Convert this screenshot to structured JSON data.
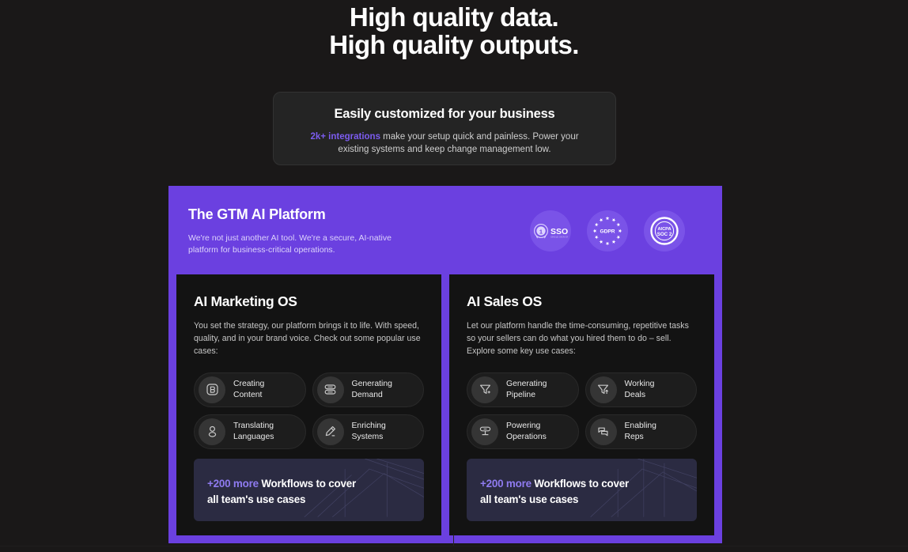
{
  "hero": {
    "line1": "High quality data.",
    "line2": "High quality outputs."
  },
  "customization": {
    "title": "Easily customized for your business",
    "accent": "2k+ integrations",
    "body": " make your setup quick and painless. Power your existing systems and keep change management low."
  },
  "platform": {
    "title": "The GTM AI Platform",
    "subtitle": "We're not just another AI tool. We're a secure, AI-native platform for business-critical operations.",
    "accent_color": "#6b40e0",
    "badges": [
      {
        "name": "sso-badge",
        "label": "SSO"
      },
      {
        "name": "gdpr-badge",
        "label": "GDPR"
      },
      {
        "name": "soc2-badge",
        "label_top": "AICPA",
        "label_bottom": "SOC 2"
      }
    ]
  },
  "cards": [
    {
      "title": "AI Marketing OS",
      "desc": "You set the strategy, our platform brings it to life. With speed, quality, and in your brand voice. Check out some popular use cases:",
      "pills": [
        {
          "icon": "content-square-icon",
          "label": "Creating\nContent"
        },
        {
          "icon": "stacked-bars-icon",
          "label": "Generating\nDemand"
        },
        {
          "icon": "person-icon",
          "label": "Translating\nLanguages"
        },
        {
          "icon": "pencil-icon",
          "label": "Enriching\nSystems"
        }
      ],
      "banner": {
        "accent": "+200 more",
        "rest": " Workflows to cover",
        "line2": "all team's use cases"
      }
    },
    {
      "title": "AI Sales OS",
      "desc": "Let our platform handle the time-consuming, repetitive tasks so your sellers can do what you hired them to do – sell. Explore some key use cases:",
      "pills": [
        {
          "icon": "funnel-plus-icon",
          "label": "Generating\nPipeline"
        },
        {
          "icon": "funnel-arrow-up-icon",
          "label": "Working\nDeals"
        },
        {
          "icon": "filter-table-icon",
          "label": "Powering\nOperations"
        },
        {
          "icon": "chat-bubbles-icon",
          "label": "Enabling\nReps"
        }
      ],
      "banner": {
        "accent": "+200 more",
        "rest": " Workflows to cover",
        "line2": "all team's use cases"
      }
    }
  ]
}
